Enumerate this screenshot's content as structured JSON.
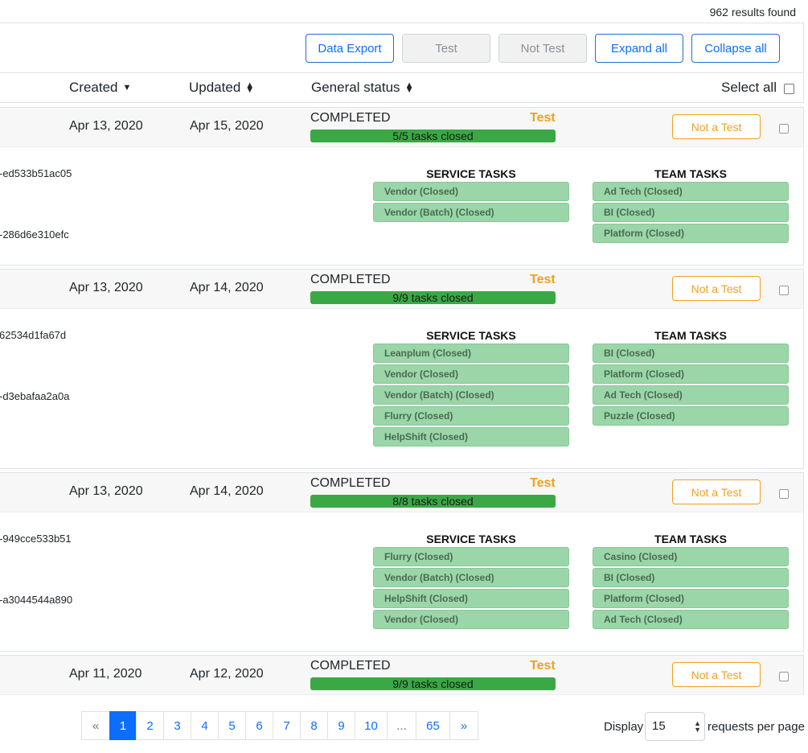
{
  "results_count": "962 results found",
  "toolbar": {
    "data_export": "Data Export",
    "test": "Test",
    "not_test": "Not Test",
    "expand_all": "Expand all",
    "collapse_all": "Collapse all"
  },
  "headers": {
    "created": "Created",
    "updated": "Updated",
    "general_status": "General status",
    "select_all": "Select all"
  },
  "requests": [
    {
      "created": "Apr 13, 2020",
      "updated": "Apr 15, 2020",
      "status": "COMPLETED",
      "type": "Test",
      "progress": "5/5 tasks closed",
      "progress_fraction": 1.0,
      "not_test_label": "Not a Test",
      "id1": "-ed533b51ac05",
      "id2": "-286d6e310efc",
      "service_title": "SERVICE TASKS",
      "team_title": "TEAM TASKS",
      "service_tasks": [
        "Vendor (Closed)",
        "Vendor (Batch) (Closed)"
      ],
      "team_tasks": [
        "Ad Tech (Closed)",
        "BI (Closed)",
        "Platform (Closed)"
      ]
    },
    {
      "created": "Apr 13, 2020",
      "updated": "Apr 14, 2020",
      "status": "COMPLETED",
      "type": "Test",
      "progress": "9/9 tasks closed",
      "progress_fraction": 1.0,
      "not_test_label": "Not a Test",
      "id1": "62534d1fa67d",
      "id2": "-d3ebafaa2a0a",
      "service_title": "SERVICE TASKS",
      "team_title": "TEAM TASKS",
      "service_tasks": [
        "Leanplum (Closed)",
        "Vendor (Closed)",
        "Vendor (Batch) (Closed)",
        "Flurry (Closed)",
        "HelpShift (Closed)"
      ],
      "team_tasks": [
        "BI (Closed)",
        "Platform (Closed)",
        "Ad Tech (Closed)",
        "Puzzle (Closed)"
      ]
    },
    {
      "created": "Apr 13, 2020",
      "updated": "Apr 14, 2020",
      "status": "COMPLETED",
      "type": "Test",
      "progress": "8/8 tasks closed",
      "progress_fraction": 1.0,
      "not_test_label": "Not a Test",
      "id1": "-949cce533b51",
      "id2": "-a3044544a890",
      "service_title": "SERVICE TASKS",
      "team_title": "TEAM TASKS",
      "service_tasks": [
        "Flurry (Closed)",
        "Vendor (Batch) (Closed)",
        "HelpShift (Closed)",
        "Vendor (Closed)"
      ],
      "team_tasks": [
        "Casino (Closed)",
        "BI (Closed)",
        "Platform (Closed)",
        "Ad Tech (Closed)"
      ]
    },
    {
      "created": "Apr 11, 2020",
      "updated": "Apr 12, 2020",
      "status": "COMPLETED",
      "type": "Test",
      "progress": "9/9 tasks closed",
      "progress_fraction": 1.0,
      "not_test_label": "Not a Test"
    }
  ],
  "pagination": {
    "prev": "«",
    "next": "»",
    "pages": [
      "1",
      "2",
      "3",
      "4",
      "5",
      "6",
      "7",
      "8",
      "9",
      "10",
      "...",
      "65"
    ],
    "current": "1"
  },
  "per_page": {
    "display_label": "Display",
    "value": "15",
    "suffix": "requests per page"
  }
}
